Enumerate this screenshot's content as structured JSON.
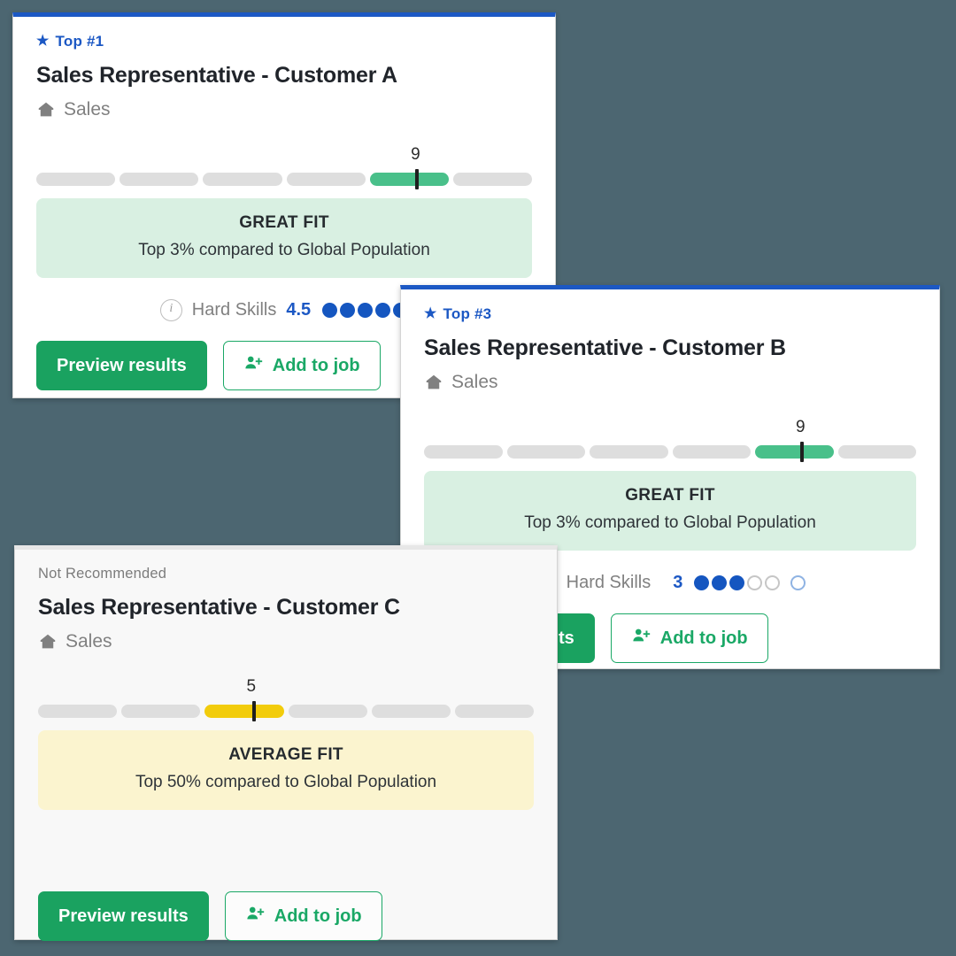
{
  "background_color": "#4c6671",
  "accent_blue": "#1c58c4",
  "green": "#1aa260",
  "bar_green": "#49c08a",
  "bar_yellow": "#f2cc0c",
  "common": {
    "department": "Sales",
    "department_icon": "home-icon",
    "info_icon": "info-circle-icon",
    "skills_label": "Hard Skills",
    "star_icon": "★",
    "preview_button": "Preview results",
    "add_button": "Add to job",
    "add_icon": "person-add-icon",
    "segments": 6
  },
  "cards": [
    {
      "id": "card-a",
      "rank_badge": "Top #1",
      "has_star": true,
      "title": "Sales Representative - Customer A",
      "department": "Sales",
      "score": 9,
      "score_label": "9",
      "active_segment": 5,
      "marker_percent": 60,
      "bar_color": "green",
      "fit_label": "GREAT FIT",
      "fit_sub": "Top 3% compared to Global Population",
      "fit_style": "great",
      "skills_label": "Hard Skills",
      "skills_value": "4.5",
      "skills_dots": [
        "full",
        "full",
        "full",
        "full",
        "half"
      ],
      "preview_button": "Preview results",
      "add_button": "Add to job"
    },
    {
      "id": "card-b",
      "rank_badge": "Top #3",
      "has_star": true,
      "title": "Sales Representative - Customer B",
      "department": "Sales",
      "score": 9,
      "score_label": "9",
      "active_segment": 5,
      "marker_percent": 60,
      "bar_color": "green",
      "fit_label": "GREAT FIT",
      "fit_sub": "Top 3% compared to Global Population",
      "fit_style": "great",
      "skills_label": "Hard Skills",
      "skills_value": "3",
      "skills_dots": [
        "full",
        "full",
        "full",
        "empty",
        "empty",
        "empty-blue"
      ],
      "preview_button": "Preview results",
      "add_button": "Add to job"
    },
    {
      "id": "card-c",
      "rank_badge": "Not Recommended",
      "has_star": false,
      "title": "Sales Representative - Customer C",
      "department": "Sales",
      "score": 5,
      "score_label": "5",
      "active_segment": 3,
      "marker_percent": 52,
      "bar_color": "yellow",
      "fit_label": "AVERAGE FIT",
      "fit_sub": "Top 50% compared to Global Population",
      "fit_style": "average",
      "skills_label": "",
      "skills_value": "",
      "skills_dots": [],
      "preview_button": "Preview results",
      "add_button": "Add to job"
    }
  ]
}
